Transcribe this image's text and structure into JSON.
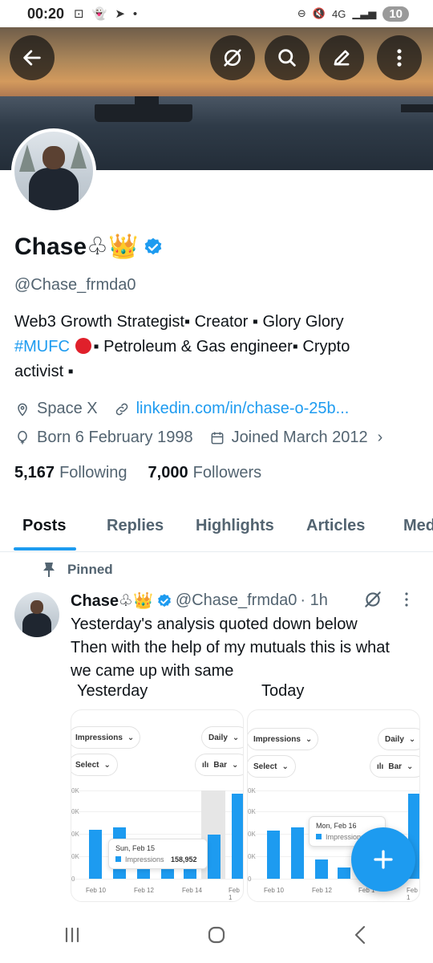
{
  "status_bar": {
    "time": "00:20",
    "network": "4G",
    "battery": "10"
  },
  "header_actions": {
    "back": "back-arrow-icon",
    "grok": "grok-icon",
    "search": "search-icon",
    "edit": "edit-pencil-icon",
    "more": "more-vertical-icon"
  },
  "profile": {
    "display_name": "Chase♧👑",
    "handle": "@Chase_frmda0",
    "bio_line1": "Web3 Growth Strategist▪︎ Creator ▪︎ Glory Glory",
    "bio_hashtag": "#MUFC",
    "bio_line2_rest": "▪︎ Petroleum & Gas engineer▪︎ Crypto",
    "bio_line3": "activist ▪︎",
    "location": "Space X",
    "website": "linkedin.com/in/chase-o-25b...",
    "birthday": "Born 6 February 1998",
    "joined": "Joined March 2012",
    "following_count": "5,167",
    "following_label": "Following",
    "followers_count": "7,000",
    "followers_label": "Followers"
  },
  "tabs": [
    "Posts",
    "Replies",
    "Highlights",
    "Articles",
    "Med"
  ],
  "pinned_post": {
    "pinned_label": "Pinned",
    "name": "Chase♧👑",
    "handle": "@Chase_frmda0",
    "time": "· 1h",
    "text_line1": "Yesterday's analysis quoted down below",
    "text_line2": "Then with the help of my mutuals this is what",
    "text_line3": "we came up with same",
    "label_left": "Yesterday",
    "label_right": "Today"
  },
  "card_left": {
    "metric": "Impressions",
    "period": "Daily",
    "select": "Select",
    "type": "Bar",
    "y_ticks": [
      "0K",
      "0K",
      "0K",
      "0K",
      "0"
    ],
    "x_ticks": [
      "Feb 10",
      "Feb 12",
      "Feb 14",
      "Feb 1"
    ],
    "tooltip_date": "Sun, Feb 15",
    "tooltip_label": "Impressions",
    "tooltip_value": "158,952"
  },
  "card_right": {
    "metric": "Impressions",
    "period": "Daily",
    "select": "Select",
    "type": "Bar",
    "y_ticks": [
      "0K",
      "0K",
      "0K",
      "0K",
      "0"
    ],
    "x_ticks": [
      "Feb 10",
      "Feb 12",
      "Feb 1",
      "Feb 1"
    ],
    "tooltip_date": "Mon, Feb 16",
    "tooltip_label": "Impressions"
  },
  "colors": {
    "accent": "#1d9bf0",
    "text": "#0f1419",
    "muted": "#536471"
  }
}
